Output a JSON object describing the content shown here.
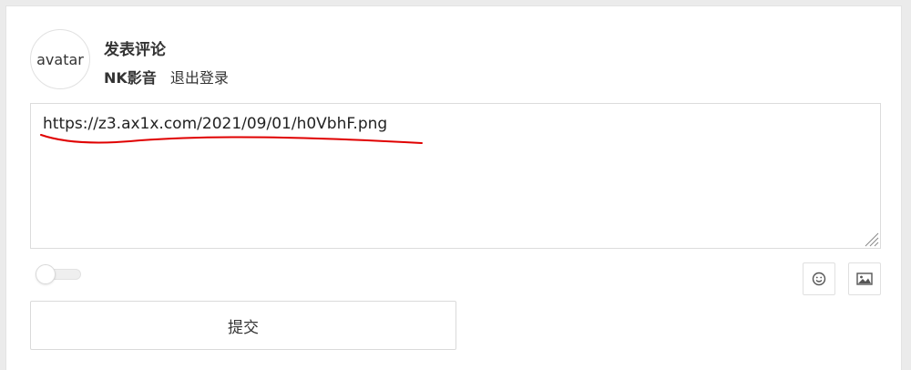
{
  "comment": {
    "avatar_text": "avatar",
    "title": "发表评论",
    "username": "NK影音",
    "logout_label": "退出登录",
    "textarea_value": "https://z3.ax1x.com/2021/09/01/h0VbhF.png",
    "submit_label": "提交",
    "toggle_state": "off",
    "tools": {
      "emoji_icon": "smiley-icon",
      "image_icon": "image-icon"
    },
    "annotation_color": "#e00000"
  }
}
